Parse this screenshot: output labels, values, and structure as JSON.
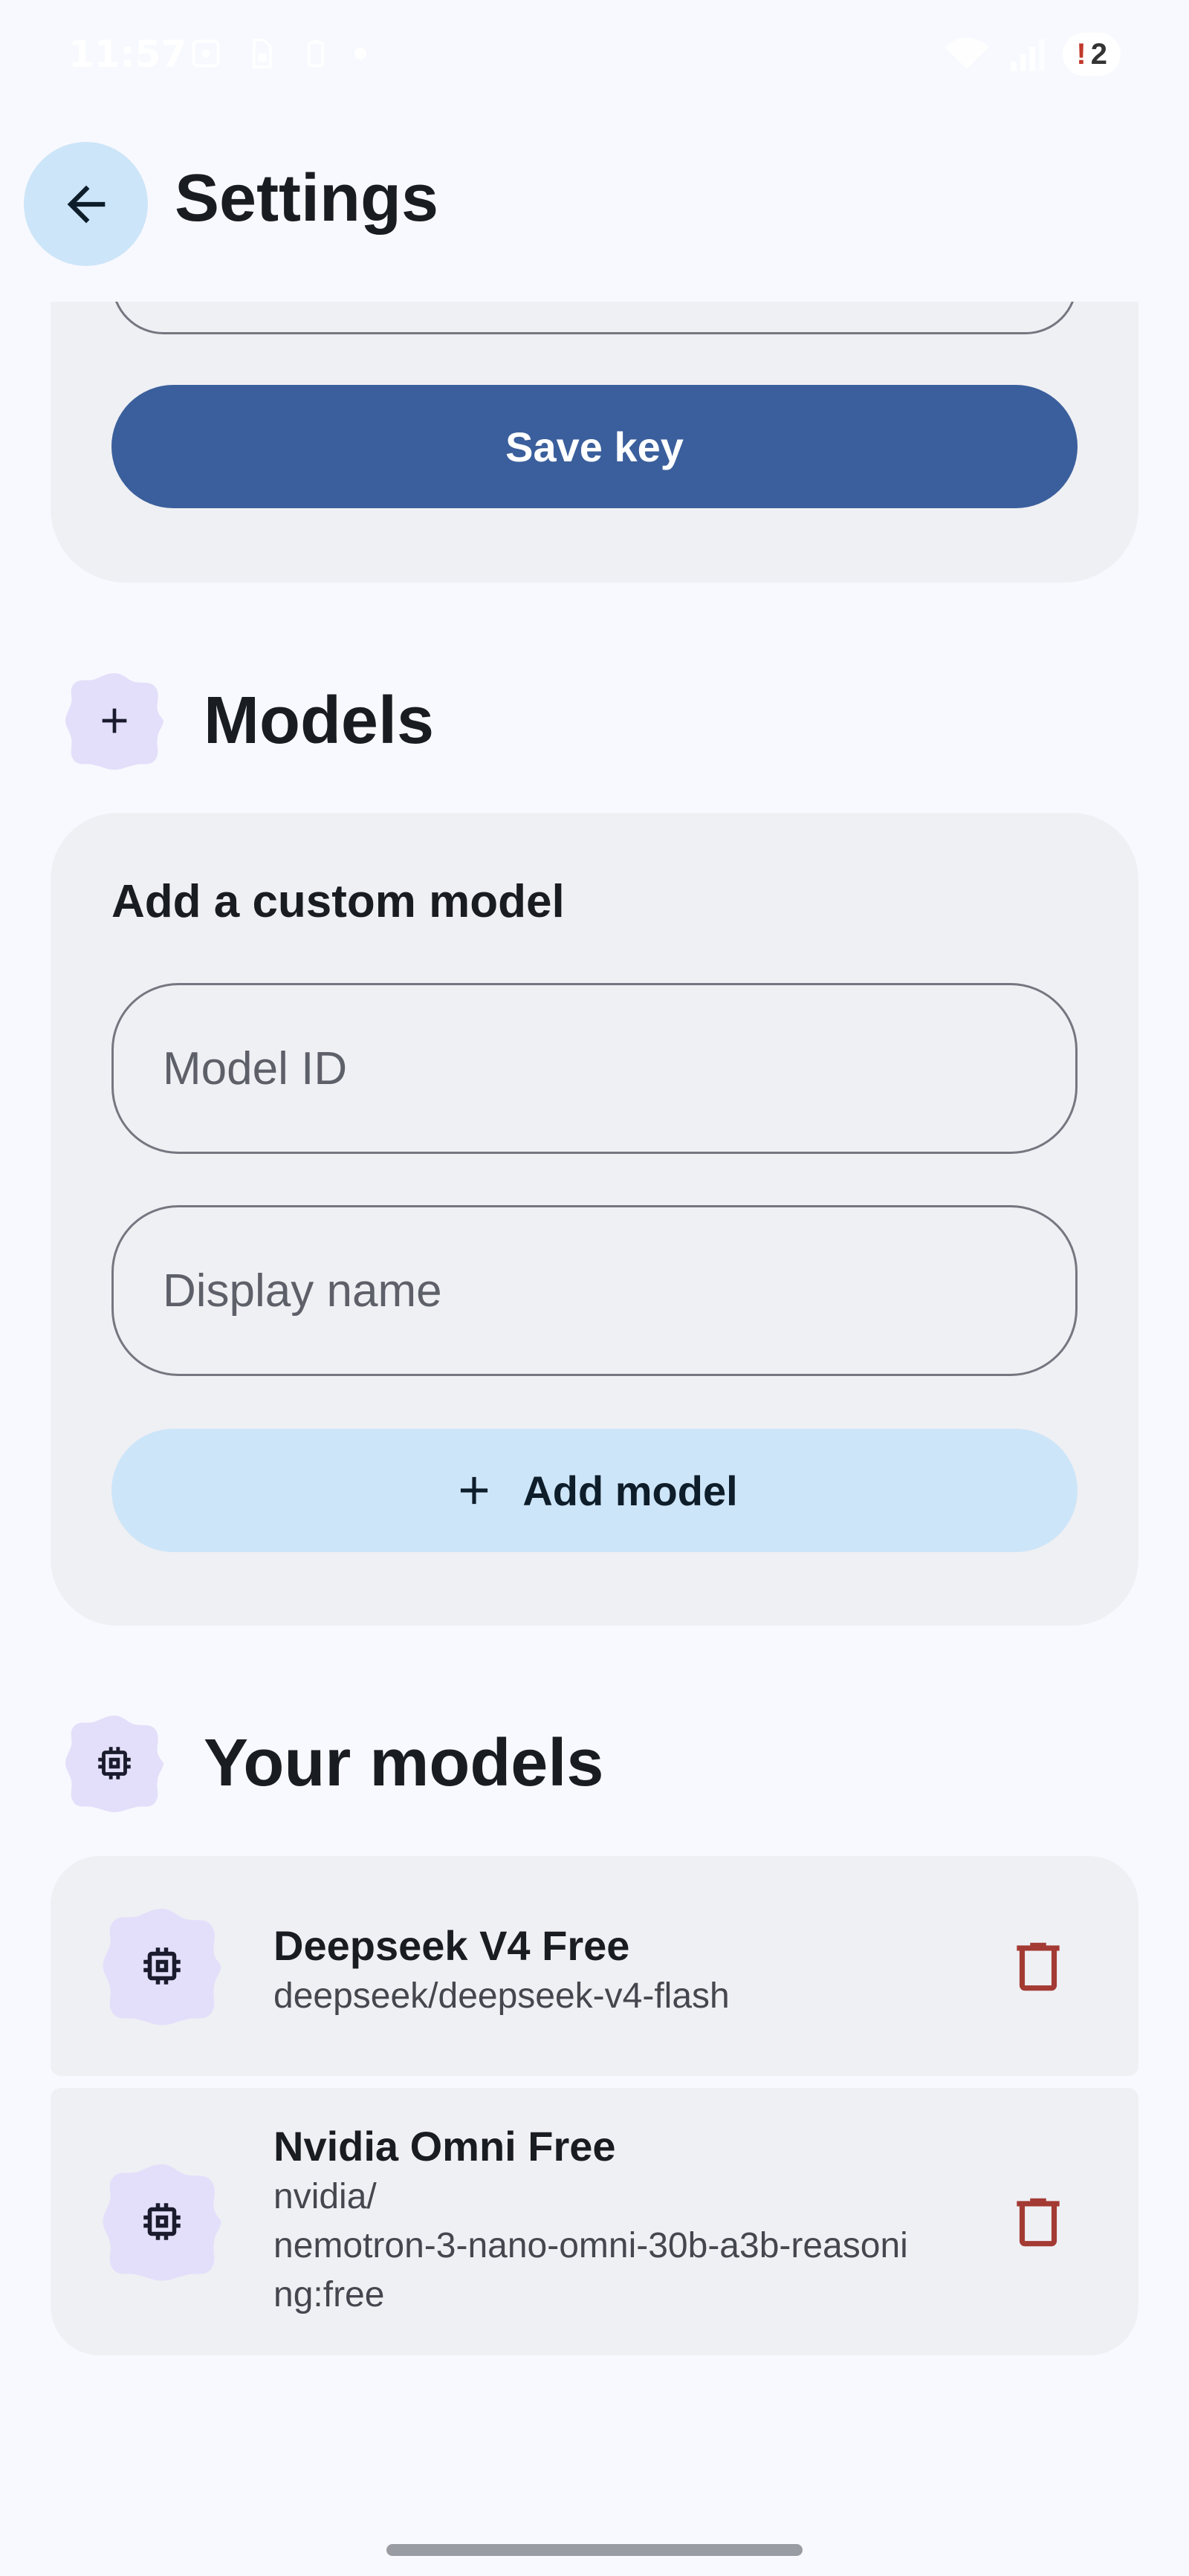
{
  "status_bar": {
    "time": "11:57",
    "notification_badge": "2",
    "badge_mark": "!",
    "icons": [
      "screenshot-icon",
      "sim-icon",
      "battery-saver-icon",
      "dot-icon",
      "wifi-icon",
      "signal-icon"
    ]
  },
  "header": {
    "title": "Settings",
    "back_icon": "arrow-back-icon"
  },
  "api_key_section": {
    "save_label": "Save key"
  },
  "models_section": {
    "title": "Models",
    "icon": "plus-icon",
    "card_title": "Add a custom model",
    "model_id_placeholder": "Model ID",
    "model_id_value": "",
    "display_name_placeholder": "Display name",
    "display_name_value": "",
    "add_label": "Add model"
  },
  "your_models_section": {
    "title": "Your models",
    "icon": "chip-icon",
    "items": [
      {
        "name": "Deepseek V4 Free",
        "id": "deepseek/deepseek-v4-flash"
      },
      {
        "name": "Nvidia Omni Free",
        "id": "nvidia/\nnemotron-3-nano-omni-30b-a3b-reasoni\nng:free"
      }
    ]
  },
  "colors": {
    "background": "#f8f9fe",
    "card": "#eff0f4",
    "primary": "#3b5f9c",
    "tonal": "#cde5f8",
    "flower": "#e3dffa",
    "delete": "#a33a33"
  }
}
